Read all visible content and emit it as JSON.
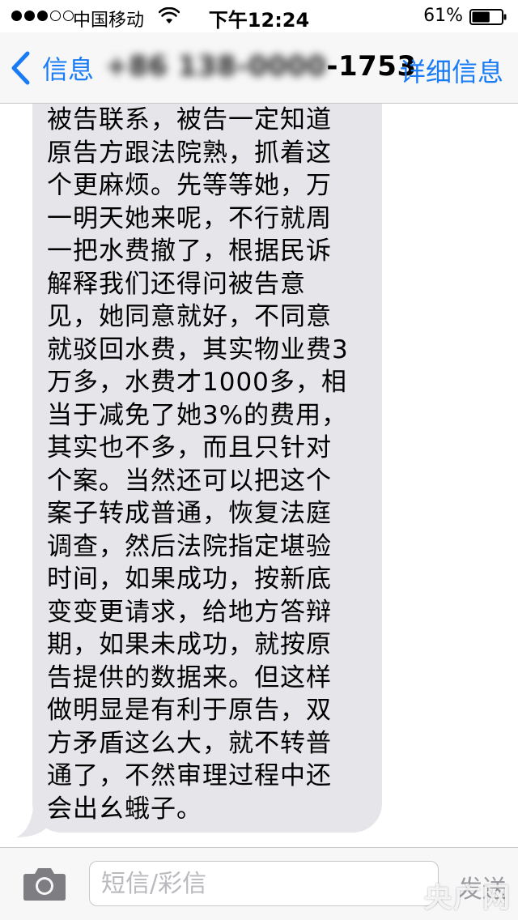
{
  "status_bar": {
    "carrier": "中国移动",
    "time": "下午12:24",
    "battery_percent": "61%",
    "signal_bars_filled": 3,
    "signal_bars_total": 5,
    "battery_level": 0.61
  },
  "nav_bar": {
    "back_label": "信息",
    "contact_blurred": "+86 138-0000",
    "contact_visible": "-1753",
    "details_label": "详细信息"
  },
  "message": {
    "lines": [
      "被告联系，被告一定知道",
      "原告方跟法院熟，抓着这",
      "个更麻烦。先等等她，万",
      "一明天她来呢，不行就周",
      "一把水费撤了，根据民诉",
      "解释我们还得问被告意",
      "见，她同意就好，不同意",
      "就驳回水费，其实物业费3",
      "万多，水费才1000多，相",
      "当于减免了她3%的费用，",
      "其实也不多，而且只针对",
      "个案。当然还可以把这个",
      "案子转成普通，恢复法庭",
      "调查，然后法院指定堪验",
      "时间，如果成功，按新底",
      "变变更请求，给地方答辩",
      "期，如果未成功，就按原",
      "告提供的数据来。但这样",
      "做明显是有利于原告，双",
      "方矛盾这么大，就不转普",
      "通了，不然审理过程中还",
      "会出幺蛾子。"
    ],
    "bubble_color": "#e5e5ea"
  },
  "input_bar": {
    "placeholder": "短信/彩信",
    "send_label": "发送",
    "camera_icon": "camera-icon"
  },
  "watermark": "央广网",
  "colors": {
    "accent": "#1a7cf5",
    "bar_background": "#f7f7f8"
  }
}
